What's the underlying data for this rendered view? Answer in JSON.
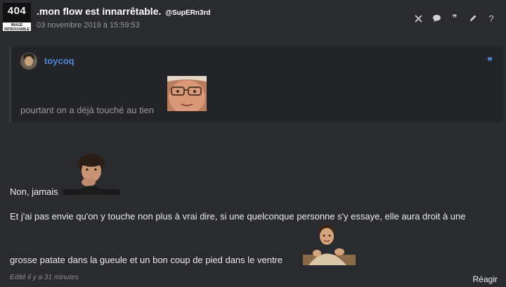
{
  "post": {
    "avatar": {
      "number": "404",
      "caption": "IMAGE INTROUVABLE"
    },
    "author": ".mon flow est innarrêtable.",
    "handle": "@SupERn3rd",
    "date": "03 novembre 2019 à 15:59:53",
    "tools": [
      "close-icon",
      "comment-icon",
      "quote-icon",
      "edit-icon",
      "help-icon"
    ],
    "tool_labels": {
      "quote": "❞",
      "help": "?"
    },
    "quote": {
      "author": "toycoq",
      "mark": "❞",
      "text": "pourtant on a déjà touché au tien"
    },
    "body": {
      "line1": "Non, jamais",
      "line2": "Et j'ai pas envie qu'on y touche non plus à vrai dire, si une quelconque personne s'y essaye, elle aura droit à une",
      "line3": "grosse patate dans la gueule et un bon coup de pied dans le ventre"
    },
    "edited": "Edité il y a 31 minutes",
    "react": "Réagir"
  }
}
